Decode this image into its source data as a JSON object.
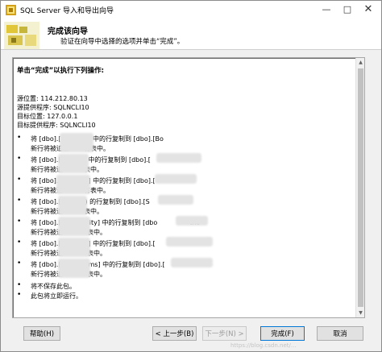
{
  "window": {
    "title": "SQL Server 导入和导出向导"
  },
  "header": {
    "title": "完成该向导",
    "subtitle": "验证在向导中选择的选项并单击“完成”。"
  },
  "summary": {
    "title": "单击“完成”以执行下列操作:",
    "info": [
      "源位置: 114.212.80.13",
      "源提供程序: SQLNCLI10",
      "目标位置: 127.0.0.1",
      "目标提供程序: SQLNCLI10"
    ],
    "operations": [
      {
        "line1": "将 [dbo].[B",
        "suffix1": "中的行复制到 [dbo].[Bo",
        "line2": "新行将被追加",
        "suffix2": "有表中。"
      },
      {
        "line1": "将 [dbo].[Fi",
        "suffix1": "] 中的行复制到 [dbo].[",
        "line2": "新行将被追",
        "suffix2": "表中。"
      },
      {
        "line1": "将 [dbo].[",
        "suffix1": "] 中的行复制到 [dbo].[",
        "line2": "新行将被追",
        "suffix2": "有表中。"
      },
      {
        "line1": "将 [dbo].[",
        "suffix1": ") 的行复制到 [dbo].[S",
        "line2": "新行将被追",
        "suffix2": "表中。"
      },
      {
        "line1": "将 [dbo].[",
        "suffix1": "rity] 中的行复制到 [dbo",
        "suffix1b": "tho",
        "line2": "新行将被追",
        "suffix2": "表中。"
      },
      {
        "line1": "将 [dbo].[",
        "suffix1": "] 中的行复制到 [dbo].[",
        "line2": "新行将被追",
        "suffix2": "表中。"
      },
      {
        "line1": "将 [dbo].[",
        "suffix1": "ms] 中的行复制到 [dbo].[",
        "line2": "新行将被追",
        "suffix2": "表中。"
      }
    ],
    "notes": [
      "将不保存此包。",
      "此包将立即运行。"
    ]
  },
  "buttons": {
    "help": "帮助(H)",
    "back": "< 上一步(B)",
    "next": "下一步(N) >",
    "finish": "完成(F)",
    "cancel": "取消"
  },
  "watermark": "https://blog.csdn.net/..."
}
